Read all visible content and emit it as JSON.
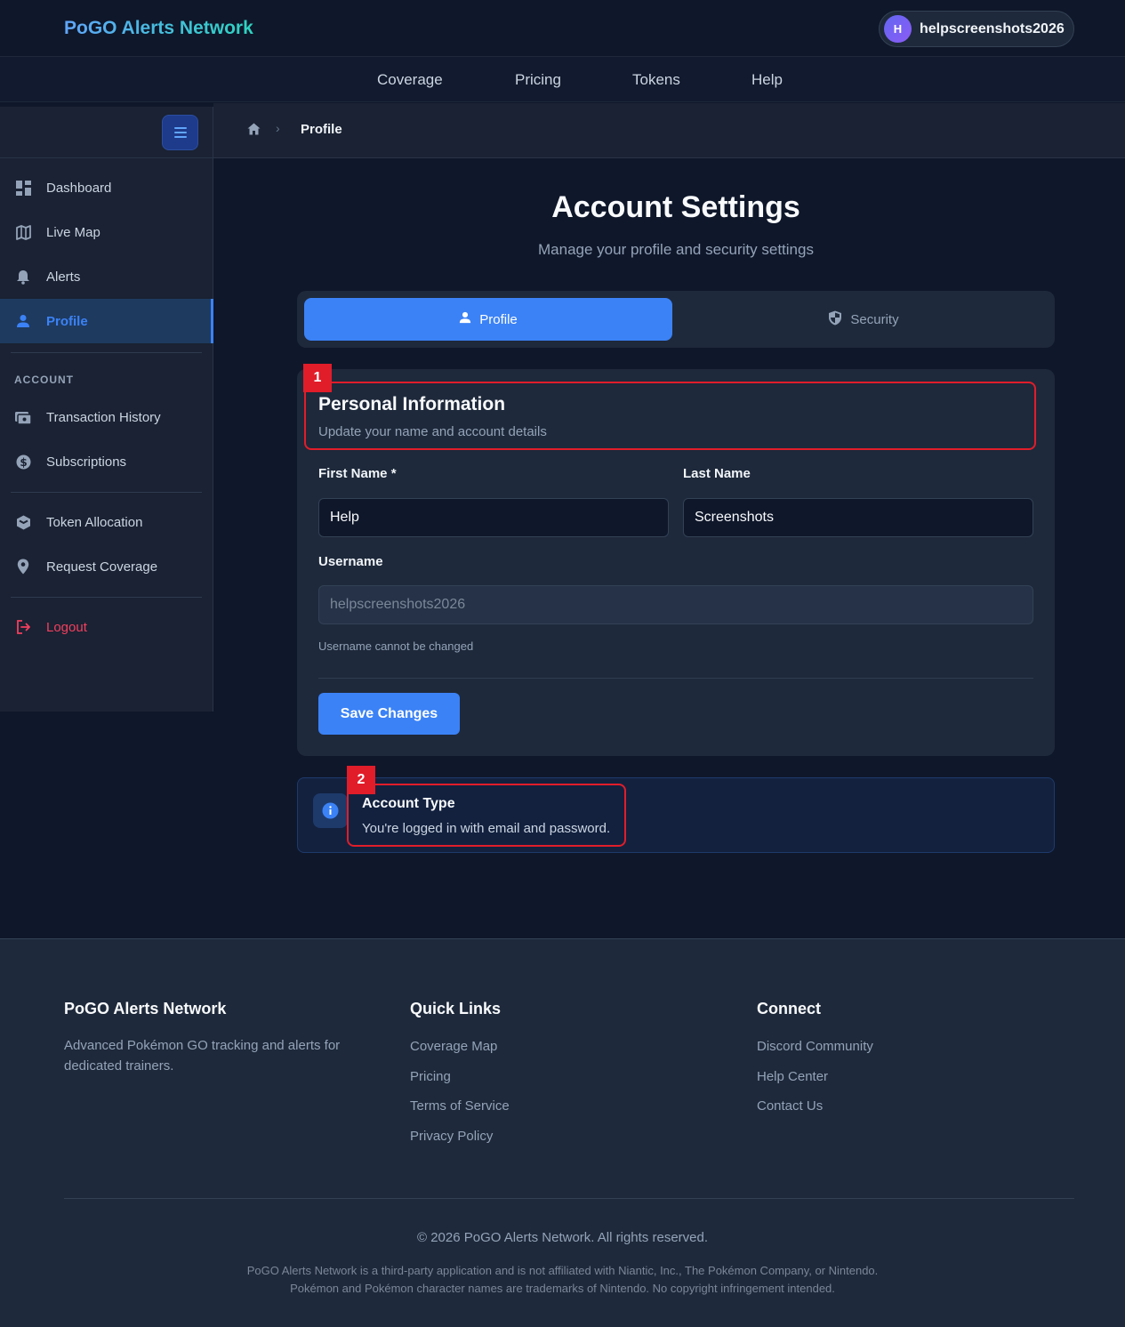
{
  "header": {
    "brand": "PoGO Alerts Network",
    "user_initial": "H",
    "username": "helpscreenshots2026"
  },
  "nav": {
    "coverage": "Coverage",
    "pricing": "Pricing",
    "tokens": "Tokens",
    "help": "Help"
  },
  "sidebar": {
    "dashboard": "Dashboard",
    "live_map": "Live Map",
    "alerts": "Alerts",
    "profile": "Profile",
    "section_account": "ACCOUNT",
    "transaction_history": "Transaction History",
    "subscriptions": "Subscriptions",
    "token_allocation": "Token Allocation",
    "request_coverage": "Request Coverage",
    "logout": "Logout"
  },
  "breadcrumb": {
    "separator": "›",
    "current": "Profile"
  },
  "page": {
    "title": "Account Settings",
    "subtitle": "Manage your profile and security settings"
  },
  "tabs": {
    "profile": "Profile",
    "security": "Security"
  },
  "personal_info": {
    "title": "Personal Information",
    "subtitle": "Update your name and account details",
    "first_name_label": "First Name *",
    "first_name_value": "Help",
    "last_name_label": "Last Name",
    "last_name_value": "Screenshots",
    "username_label": "Username",
    "username_value": "helpscreenshots2026",
    "username_hint": "Username cannot be changed",
    "save_label": "Save Changes"
  },
  "account_type": {
    "title": "Account Type",
    "text": "You're logged in with email and password."
  },
  "annotations": {
    "first": "1",
    "second": "2"
  },
  "footer": {
    "brand_title": "PoGO Alerts Network",
    "brand_desc": "Advanced Pokémon GO tracking and alerts for dedicated trainers.",
    "quick_links_title": "Quick Links",
    "quick_links": [
      "Coverage Map",
      "Pricing",
      "Terms of Service",
      "Privacy Policy"
    ],
    "connect_title": "Connect",
    "connect_links": [
      "Discord Community",
      "Help Center",
      "Contact Us"
    ],
    "copyright": "© 2026 PoGO Alerts Network. All rights reserved.",
    "disclaimer_1": "PoGO Alerts Network is a third-party application and is not affiliated with Niantic, Inc., The Pokémon Company, or Nintendo.",
    "disclaimer_2": "Pokémon and Pokémon character names are trademarks of Nintendo. No copyright infringement intended."
  },
  "colors": {
    "accent": "#3b82f6",
    "background": "#0f172a",
    "surface": "#1e293b",
    "annotation": "#e11d2a",
    "logout": "#f43f5e"
  }
}
